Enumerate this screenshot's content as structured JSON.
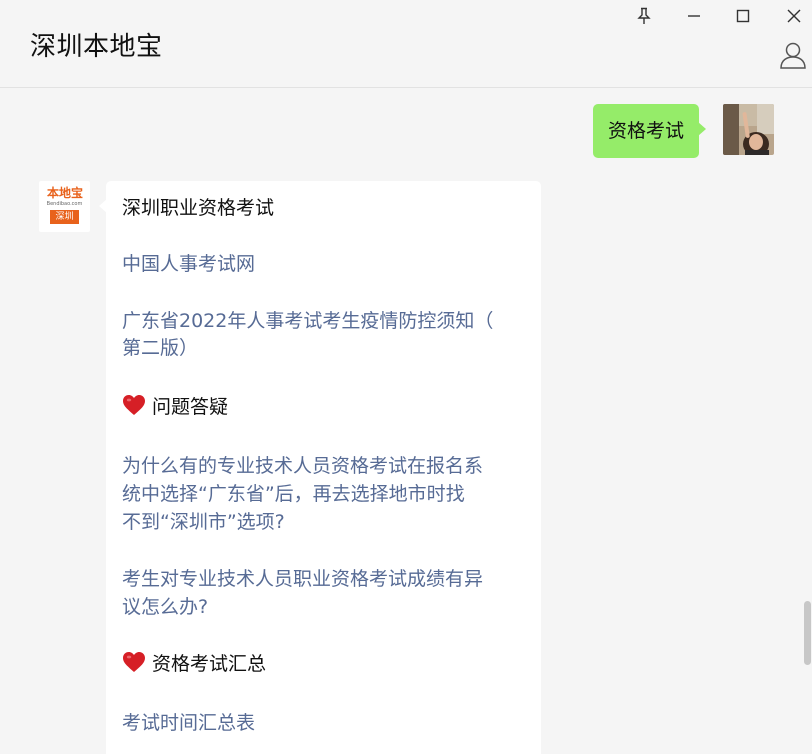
{
  "window": {
    "title": "深圳本地宝",
    "icons": {
      "pin": "pin-icon",
      "minimize": "minimize-icon",
      "maximize": "maximize-icon",
      "close": "close-icon",
      "profile": "person-icon"
    }
  },
  "messages": {
    "outgoing": {
      "text": "资格考试",
      "bubble_color": "#95ec69"
    },
    "incoming": {
      "avatar_logo": {
        "brand_text": "本地宝",
        "sub_text": "Bendibao.com",
        "badge_text": "深圳",
        "brand_color": "#e8621c"
      },
      "lines": [
        {
          "type": "plain",
          "text": "深圳职业资格考试"
        },
        {
          "type": "link",
          "text": "中国人事考试网"
        },
        {
          "type": "link",
          "text": "广东省2022年人事考试考生疫情防控须知（"
        },
        {
          "type": "link",
          "text": "第二版）"
        },
        {
          "type": "heading",
          "text": "问题答疑"
        },
        {
          "type": "link",
          "text": "为什么有的专业技术人员资格考试在报名系"
        },
        {
          "type": "link",
          "text": "统中选择“广东省”后，再去选择地市时找"
        },
        {
          "type": "link",
          "text": "不到“深圳市”选项?"
        },
        {
          "type": "link",
          "text": "考生对专业技术人员职业资格考试成绩有异"
        },
        {
          "type": "link",
          "text": "议怎么办?"
        },
        {
          "type": "heading",
          "text": "资格考试汇总"
        },
        {
          "type": "link",
          "text": "考试时间汇总表"
        }
      ],
      "link_color": "#576b95",
      "heart_icon": "red-heart-icon"
    }
  }
}
